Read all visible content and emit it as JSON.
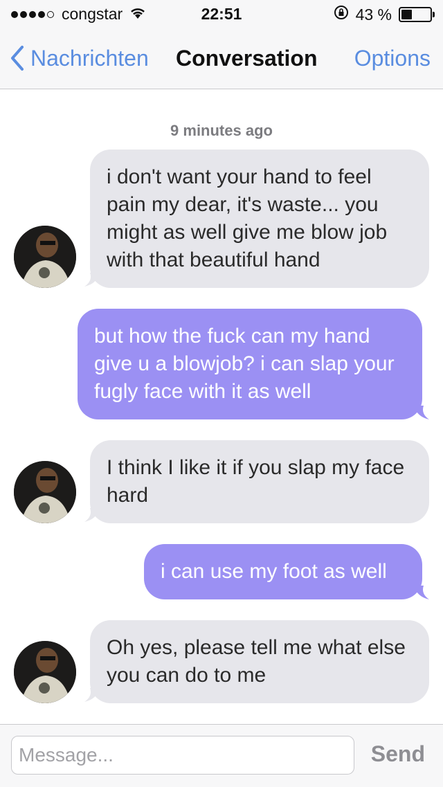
{
  "status_bar": {
    "carrier": "congstar",
    "time": "22:51",
    "battery_text": "43 %",
    "battery_level": 0.43,
    "signal_bars": 4
  },
  "nav": {
    "back_label": "Nachrichten",
    "title": "Conversation",
    "options_label": "Options"
  },
  "conversation": {
    "timestamp": "9 minutes ago",
    "messages": [
      {
        "direction": "incoming",
        "text": "i don't want your hand to feel pain my dear, it's waste... you might as well give me blow job with that beautiful hand"
      },
      {
        "direction": "outgoing",
        "text": "but how the fuck can my hand give u a blowjob? i can slap your fugly face with it as well"
      },
      {
        "direction": "incoming",
        "text": "I think I like it if you slap my face hard"
      },
      {
        "direction": "outgoing",
        "text": "i can use my foot as well"
      },
      {
        "direction": "incoming",
        "text": "Oh yes, please tell me what else you can do to me"
      }
    ]
  },
  "composer": {
    "placeholder": "Message...",
    "send_label": "Send"
  },
  "colors": {
    "accent": "#5a8de0",
    "incoming_bubble": "#e6e6eb",
    "outgoing_bubble": "#9b90f3"
  }
}
